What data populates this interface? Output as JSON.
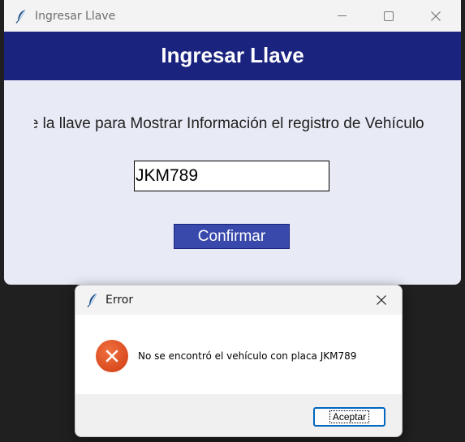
{
  "main_window": {
    "title": "Ingresar Llave",
    "header": "Ingresar Llave",
    "instruction": "Ingrese la llave para Mostrar Información el registro de Vehículo",
    "key_value": "JKM789",
    "confirm_label": "Confirmar",
    "icons": {
      "app": "feather-icon",
      "minimize": "minimize-icon",
      "maximize": "maximize-icon",
      "close": "close-icon"
    }
  },
  "error_dialog": {
    "title": "Error",
    "message": "No se encontró el vehículo con placa JKM789",
    "ok_label": "Aceptar",
    "icons": {
      "app": "feather-icon",
      "error": "error-icon",
      "close": "close-icon"
    }
  },
  "colors": {
    "header_bg": "#1a237e",
    "window_bg": "#e8eaf6",
    "button_bg": "#3949ab",
    "error_icon": "#e04a18"
  }
}
